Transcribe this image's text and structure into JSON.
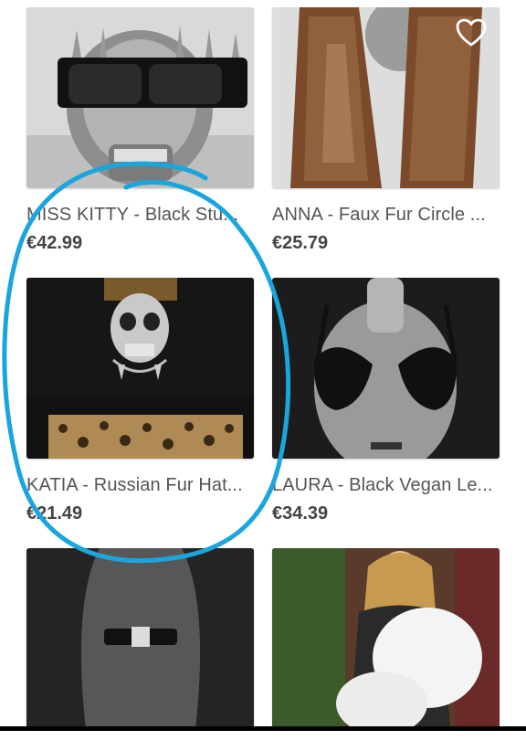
{
  "products": [
    {
      "title": "MISS KITTY - Black Stu...",
      "price": "€42.99",
      "image": "skull-sunglasses-image"
    },
    {
      "title": "ANNA - Faux Fur Circle ...",
      "price": "€25.79",
      "image": "fur-scarf-image",
      "favorite_icon": "heart-outline-icon"
    },
    {
      "title": "KATIA - Russian Fur Hat...",
      "price": "€21.49",
      "image": "leopard-hat-skull-image"
    },
    {
      "title": "LAURA - Black Vegan Le...",
      "price": "€34.39",
      "image": "black-bra-image"
    },
    {
      "title": "",
      "price": "",
      "image": "mesh-bodysuit-image"
    },
    {
      "title": "",
      "price": "",
      "image": "white-fur-stole-image"
    }
  ],
  "colors": {
    "annotation": "#1aa6dc",
    "text": "#555555",
    "price": "#444444"
  }
}
